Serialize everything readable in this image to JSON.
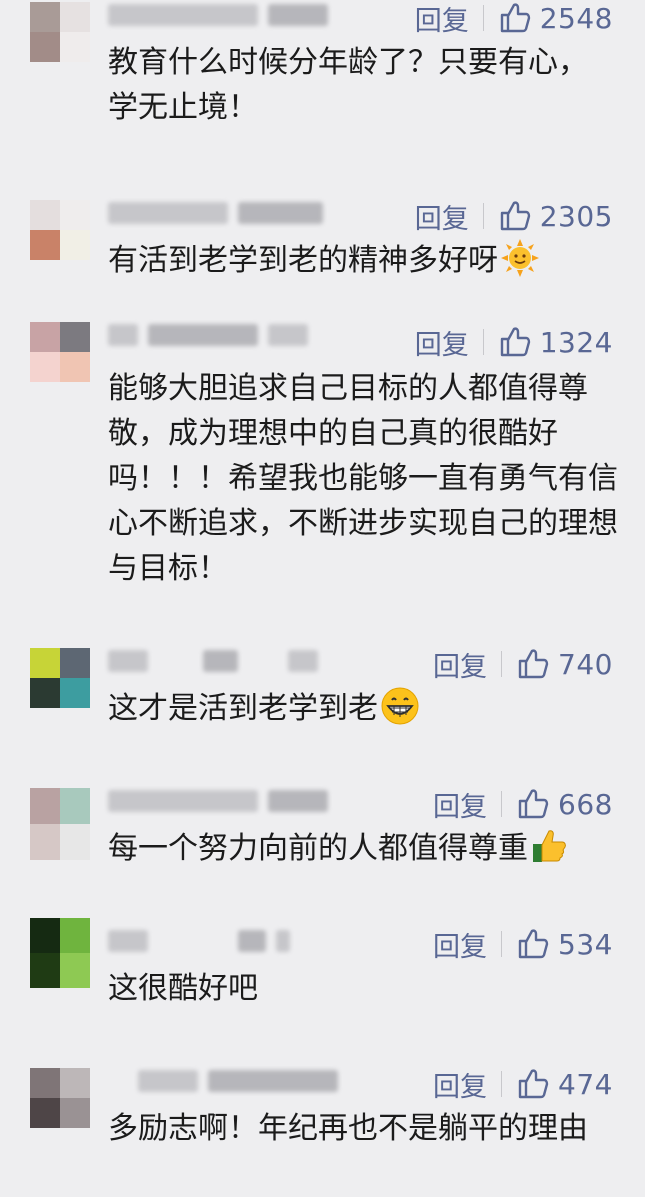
{
  "comments": [
    {
      "reply_label": "回复",
      "likes": "2548",
      "text": "教育什么时候分年龄了？只要有心，学无止境！",
      "avatar_colors": [
        "#a99b97",
        "#e6e1e1",
        "#a28c88",
        "#efecec"
      ]
    },
    {
      "reply_label": "回复",
      "likes": "2305",
      "text": "有活到老学到老的精神多好呀",
      "emoji": "sun-emoji",
      "avatar_colors": [
        "#e4dede",
        "#efeded",
        "#c98268",
        "#f1efe6"
      ]
    },
    {
      "reply_label": "回复",
      "likes": "1324",
      "text": "能够大胆追求自己目标的人都值得尊敬，成为理想中的自己真的很酷好吗！！！希望我也能够一直有勇气有信心不断追求，不断进步实现自己的理想与目标！",
      "avatar_colors": [
        "#c8a3a5",
        "#7c7a80",
        "#f4d3cf",
        "#f0c5b3"
      ]
    },
    {
      "reply_label": "回复",
      "likes": "740",
      "text": "这才是活到老学到老",
      "emoji": "grin-emoji",
      "avatar_colors": [
        "#c7d437",
        "#5d6773",
        "#2b3a32",
        "#3d9da0"
      ]
    },
    {
      "reply_label": "回复",
      "likes": "668",
      "text": "每一个努力向前的人都值得尊重",
      "emoji": "thumbs-up-emoji",
      "avatar_colors": [
        "#b9a2a2",
        "#a8c9bd",
        "#d6c8c6",
        "#e7e7e7"
      ]
    },
    {
      "reply_label": "回复",
      "likes": "534",
      "text": "这很酷好吧",
      "avatar_colors": [
        "#152a12",
        "#6fb43e",
        "#1f3b14",
        "#8ec953"
      ]
    },
    {
      "reply_label": "回复",
      "likes": "474",
      "text": "多励志啊！年纪再也不是躺平的理由",
      "avatar_colors": [
        "#7f7577",
        "#bdb7b8",
        "#4e4547",
        "#9a9294"
      ]
    }
  ],
  "icons": {
    "like": "thumbs-up-outline-icon"
  },
  "colors": {
    "action": "#596794",
    "text": "#1b1b1b",
    "background": "#eeeef0"
  }
}
